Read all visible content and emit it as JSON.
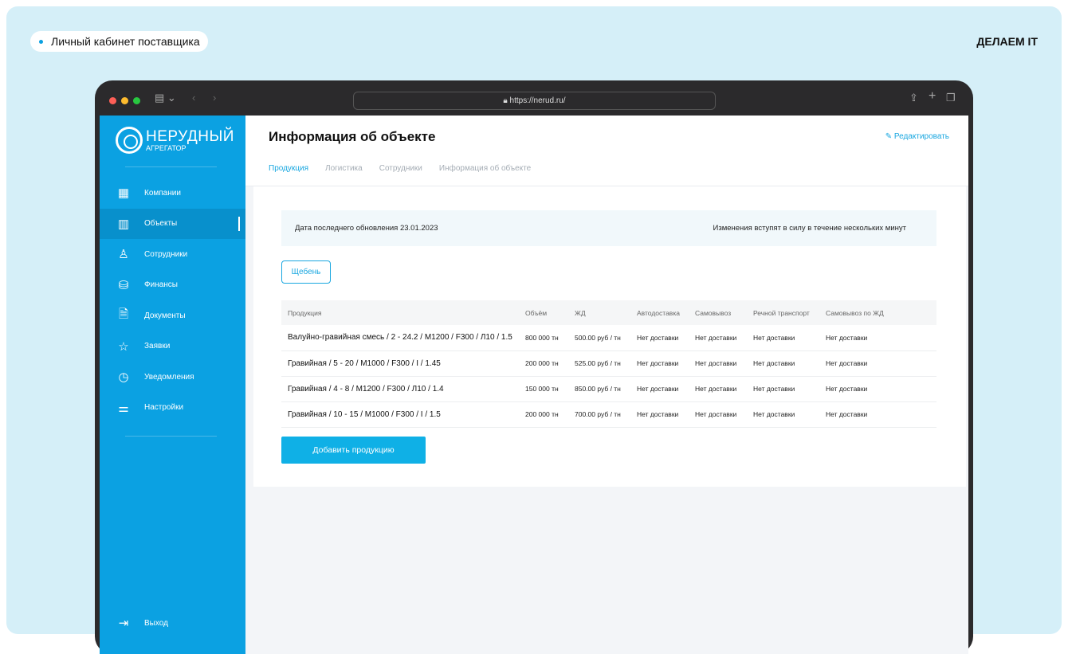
{
  "caption": "Личный кабинет поставщика",
  "brand": "ДЕЛАЕМ IT",
  "browser": {
    "url": "https://nerud.ru/"
  },
  "logo": {
    "line1": "НЕРУДНЫЙ",
    "line2": "АГРЕГАТОР"
  },
  "sidebar": {
    "items": [
      {
        "label": "Компании",
        "icon": "grid-icon",
        "glyph": "▦"
      },
      {
        "label": "Объекты",
        "icon": "building-icon",
        "glyph": "▥"
      },
      {
        "label": "Сотрудники",
        "icon": "user-icon",
        "glyph": "♙"
      },
      {
        "label": "Финансы",
        "icon": "coins-icon",
        "glyph": "⛁"
      },
      {
        "label": "Документы",
        "icon": "document-icon",
        "glyph": "🗎"
      },
      {
        "label": "Заявки",
        "icon": "star-icon",
        "glyph": "☆"
      },
      {
        "label": "Уведомления",
        "icon": "clock-icon",
        "glyph": "◷"
      },
      {
        "label": "Настройки",
        "icon": "sliders-icon",
        "glyph": "⚌"
      }
    ],
    "logout": "Выход"
  },
  "header": {
    "title": "Информация об объекте",
    "edit": "Редактировать",
    "tabs": [
      "Продукция",
      "Логистика",
      "Сотрудники",
      "Информация об объекте"
    ]
  },
  "info": {
    "updated": "Дата последнего обновления 23.01.2023",
    "note": "Изменения вступят в силу в течение нескольких минут"
  },
  "chip": "Щебень",
  "table": {
    "headers": [
      "Продукция",
      "Объём",
      "ЖД",
      "Автодоставка",
      "Самовывоз",
      "Речной транспорт",
      "Самовывоз по ЖД"
    ],
    "rows": [
      [
        "Валуйно-гравийная смесь / 2 - 24.2 / М1200 / F300 / Л10 / 1.5",
        "800 000 тн",
        "500.00 руб / тн",
        "Нет доставки",
        "Нет доставки",
        "Нет доставки",
        "Нет доставки"
      ],
      [
        "Гравийная / 5 - 20 / М1000 / F300 / I / 1.45",
        "200 000 тн",
        "525.00 руб / тн",
        "Нет доставки",
        "Нет доставки",
        "Нет доставки",
        "Нет доставки"
      ],
      [
        "Гравийная / 4 - 8 / М1200 / F300 / Л10 / 1.4",
        "150 000 тн",
        "850.00 руб / тн",
        "Нет доставки",
        "Нет доставки",
        "Нет доставки",
        "Нет доставки"
      ],
      [
        "Гравийная / 10 - 15 / М1000 / F300 / I / 1.5",
        "200 000 тн",
        "700.00 руб / тн",
        "Нет доставки",
        "Нет доставки",
        "Нет доставки",
        "Нет доставки"
      ]
    ]
  },
  "add_button": "Добавить продукцию"
}
